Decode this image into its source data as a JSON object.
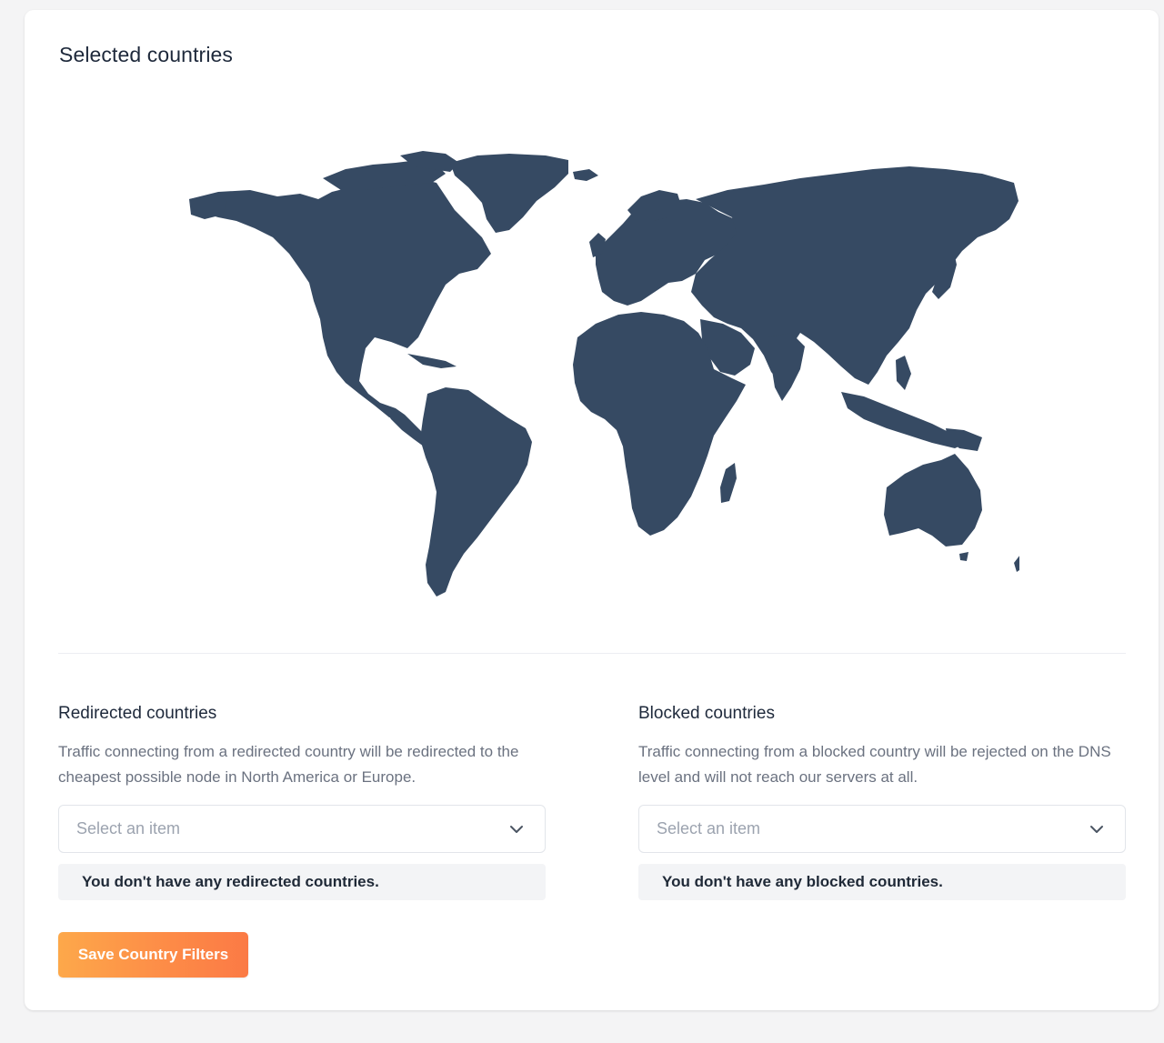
{
  "page": {
    "title": "Selected countries"
  },
  "map": {
    "land_color": "#364a63",
    "background": "#ffffff"
  },
  "redirected": {
    "heading": "Redirected countries",
    "description": "Traffic connecting from a redirected country will be redirected to the cheapest possible node in North America or Europe.",
    "placeholder": "Select an item",
    "empty_message": "You don't have any redirected countries."
  },
  "blocked": {
    "heading": "Blocked countries",
    "description": "Traffic connecting from a blocked country will be rejected on the DNS level and will not reach our servers at all.",
    "placeholder": "Select an item",
    "empty_message": "You don't have any blocked countries."
  },
  "actions": {
    "save_label": "Save Country Filters"
  },
  "colors": {
    "accent_start": "#fda84a",
    "accent_end": "#fb7a45",
    "text_muted": "#6b7280",
    "text_heading": "#1e293b"
  },
  "icons": {
    "select_chevron": "chevron-down-icon"
  }
}
